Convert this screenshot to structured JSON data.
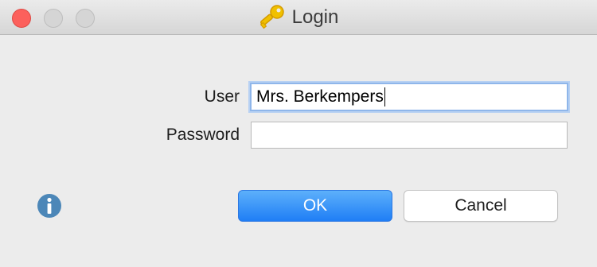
{
  "window": {
    "title": "Login",
    "title_icon": "key-icon",
    "accent_color": "#1f7ef5",
    "title_icon_color": "#f0c000"
  },
  "traffic_lights": {
    "close_color": "#fc605c",
    "minimize_color": "#d5d5d5",
    "maximize_color": "#d5d5d5"
  },
  "form": {
    "user_label": "User",
    "user_value": "Mrs. Berkempers",
    "password_label": "Password",
    "password_value": ""
  },
  "buttons": {
    "ok_label": "OK",
    "cancel_label": "Cancel"
  },
  "info": {
    "icon": "info-icon",
    "color": "#4c87b8"
  }
}
